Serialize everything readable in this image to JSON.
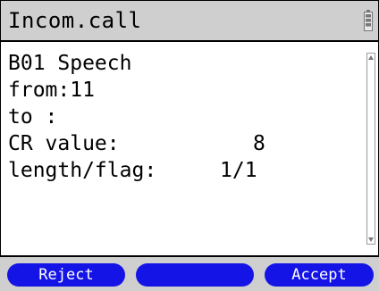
{
  "header": {
    "title": "Incom.call",
    "battery_icon": "battery-icon"
  },
  "message": {
    "line1": "B01 Speech",
    "line2": "from:11",
    "line3": "to :",
    "cr_label": "CR value:",
    "cr_value": "8",
    "length_label": "length/flag:",
    "length_value": "1/1"
  },
  "softkeys": {
    "left": "Reject",
    "middle": "",
    "right": "Accept"
  },
  "colors": {
    "softkey_bg": "#1414e6",
    "bar_bg": "#cfcfcf"
  }
}
